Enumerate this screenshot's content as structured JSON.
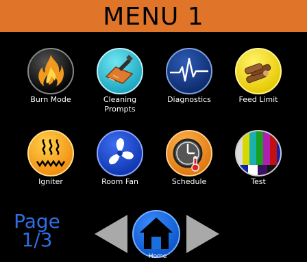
{
  "header": {
    "title": "MENU 1"
  },
  "tiles": [
    {
      "label": "Burn Mode",
      "icon": "flame-icon"
    },
    {
      "label": "Cleaning\nPrompts",
      "icon": "cleaning-shovel-icon"
    },
    {
      "label": "Diagnostics",
      "icon": "heartbeat-icon"
    },
    {
      "label": "Feed Limit",
      "icon": "wood-logs-icon"
    },
    {
      "label": "Igniter",
      "icon": "igniter-coil-icon"
    },
    {
      "label": "Room Fan",
      "icon": "fan-icon"
    },
    {
      "label": "Schedule",
      "icon": "clock-thermometer-icon"
    },
    {
      "label": "Test",
      "icon": "test-pattern-icon"
    }
  ],
  "footer": {
    "page_label": "Page\n1/3",
    "home_label": "Home"
  },
  "colors": {
    "header_bg": "#e0752a",
    "page_text": "#2f6fe6",
    "home_button": "#1a6fe0",
    "arrow": "#a9a9a9"
  }
}
